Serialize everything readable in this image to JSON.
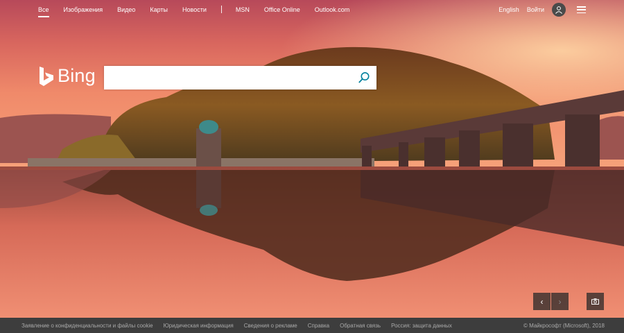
{
  "nav": {
    "links": [
      "Все",
      "Изображения",
      "Видео",
      "Карты",
      "Новости"
    ],
    "links2": [
      "MSN",
      "Office Online",
      "Outlook.com"
    ],
    "english": "English",
    "signin": "Войти"
  },
  "logo": {
    "text": "Bing"
  },
  "search": {
    "value": "",
    "placeholder": ""
  },
  "footer": {
    "links": [
      "Заявление о конфиденциальности и файлы cookie",
      "Юридическая информация",
      "Сведения о рекламе",
      "Справка",
      "Обратная связь",
      "Россия: защита данных"
    ],
    "copyright": "© Майкрософт (Microsoft), 2018"
  },
  "carousel": {
    "prev": "‹",
    "next": "›"
  },
  "colors": {
    "footer_bg": "#2d2d2d",
    "search_icon": "#00809d"
  }
}
